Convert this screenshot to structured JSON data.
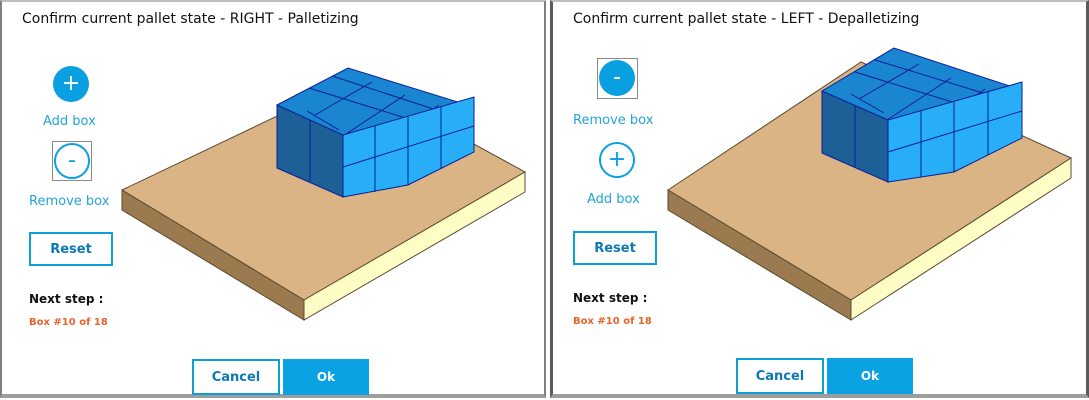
{
  "panels": [
    {
      "title": "Confirm current pallet state - RIGHT - Palletizing",
      "add_box_label": "Add box",
      "remove_box_label": "Remove box",
      "reset_label": "Reset",
      "next_step_label": "Next step :",
      "next_step_value": "Box #10 of 18",
      "cancel_label": "Cancel",
      "ok_label": "Ok"
    },
    {
      "title": "Confirm current pallet state - LEFT - Depalletizing",
      "remove_box_label": "Remove box",
      "add_box_label": "Add box",
      "reset_label": "Reset",
      "next_step_label": "Next step :",
      "next_step_value": "Box #10 of 18",
      "cancel_label": "Cancel",
      "ok_label": "Ok"
    }
  ],
  "icons": {
    "plus": "+",
    "minus": "-"
  },
  "colors": {
    "accent": "#099fe0",
    "orange": "#e8632b",
    "pallet_top": "#dbb486",
    "box_top": "#1a85d0",
    "box_side": "#27aef7"
  }
}
